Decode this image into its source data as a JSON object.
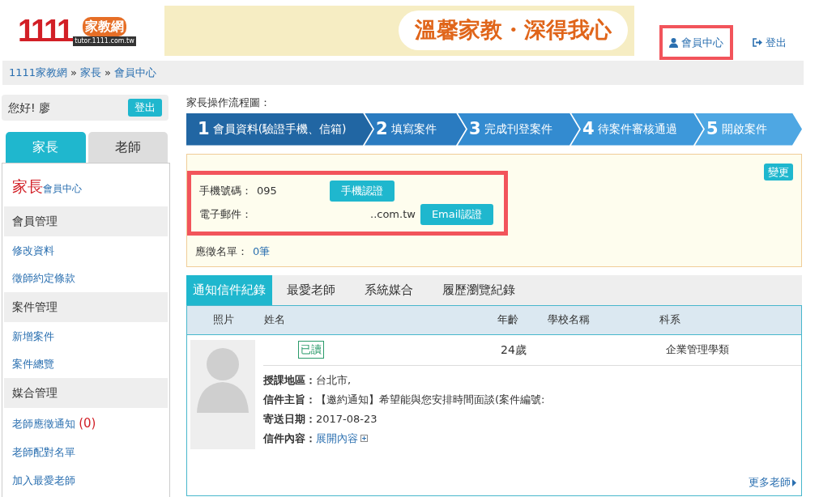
{
  "header": {
    "logo": {
      "number": "1111",
      "brand": "家教網",
      "url": "tutor.1111.com.tw"
    },
    "banner": {
      "slogan": "溫馨家教・深得我心"
    },
    "nav": [
      {
        "label": "會員中心",
        "highlighted": true
      },
      {
        "label": "登出",
        "highlighted": false
      }
    ]
  },
  "breadcrumb": {
    "separator": "»",
    "items": [
      "1111家教網",
      "家長",
      "會員中心"
    ]
  },
  "sidebar": {
    "greeting": "您好! 廖",
    "logout": "登出",
    "tabs": [
      {
        "label": "家長",
        "selected": true
      },
      {
        "label": "老師",
        "selected": false
      }
    ],
    "heading": {
      "role": "家長",
      "suffix": "會員中心"
    },
    "sections": [
      {
        "title": "會員管理",
        "items": [
          {
            "label": "修改資料"
          },
          {
            "label": "徵師約定條款"
          }
        ]
      },
      {
        "title": "案件管理",
        "items": [
          {
            "label": "新增案件"
          },
          {
            "label": "案件總覽"
          }
        ]
      },
      {
        "title": "媒合管理",
        "items": [
          {
            "label": "老師應徵通知",
            "count": "(0)"
          },
          {
            "label": "老師配對名單"
          },
          {
            "label": "加入最愛老師"
          }
        ]
      }
    ]
  },
  "flow": {
    "title": "家長操作流程圖：",
    "steps": [
      {
        "number": "1",
        "label": "會員資料(驗證手機、信箱)"
      },
      {
        "number": "2",
        "label": "填寫案件"
      },
      {
        "number": "3",
        "label": "完成刊登案件"
      },
      {
        "number": "4",
        "label": "待案件審核通過"
      },
      {
        "number": "5",
        "label": "開啟案件"
      }
    ]
  },
  "profile": {
    "change_button": "變更",
    "highlighted": true,
    "phone": {
      "label": "手機號碼：",
      "value": "095",
      "button": "手機認證"
    },
    "email": {
      "label": "電子郵件：",
      "value": "..com.tw",
      "button": "Email認證"
    },
    "applicants": {
      "label": "應徵名單：",
      "value": "0筆"
    }
  },
  "records": {
    "tabs": [
      {
        "label": "通知信件紀錄",
        "selected": true
      },
      {
        "label": "最愛老師",
        "selected": false
      },
      {
        "label": "系統媒合",
        "selected": false
      },
      {
        "label": "履歷瀏覽紀錄",
        "selected": false
      }
    ],
    "columns": [
      "照片",
      "姓名",
      "年齡",
      "學校名稱",
      "科系"
    ],
    "rows": [
      {
        "status": "已讀",
        "age": "24歲",
        "department": "企業管理學類",
        "details": [
          {
            "label": "授課地區：",
            "value": "台北市,",
            "kind": "text"
          },
          {
            "label": "信件主旨：",
            "value": "【邀約通知】希望能與您安排時間面談(案件編號:",
            "kind": "text"
          },
          {
            "label": "寄送日期：",
            "value": "2017-08-23",
            "kind": "text"
          },
          {
            "label": "信件內容：",
            "value": "展開內容",
            "kind": "link"
          }
        ]
      }
    ],
    "more": "更多老師"
  }
}
